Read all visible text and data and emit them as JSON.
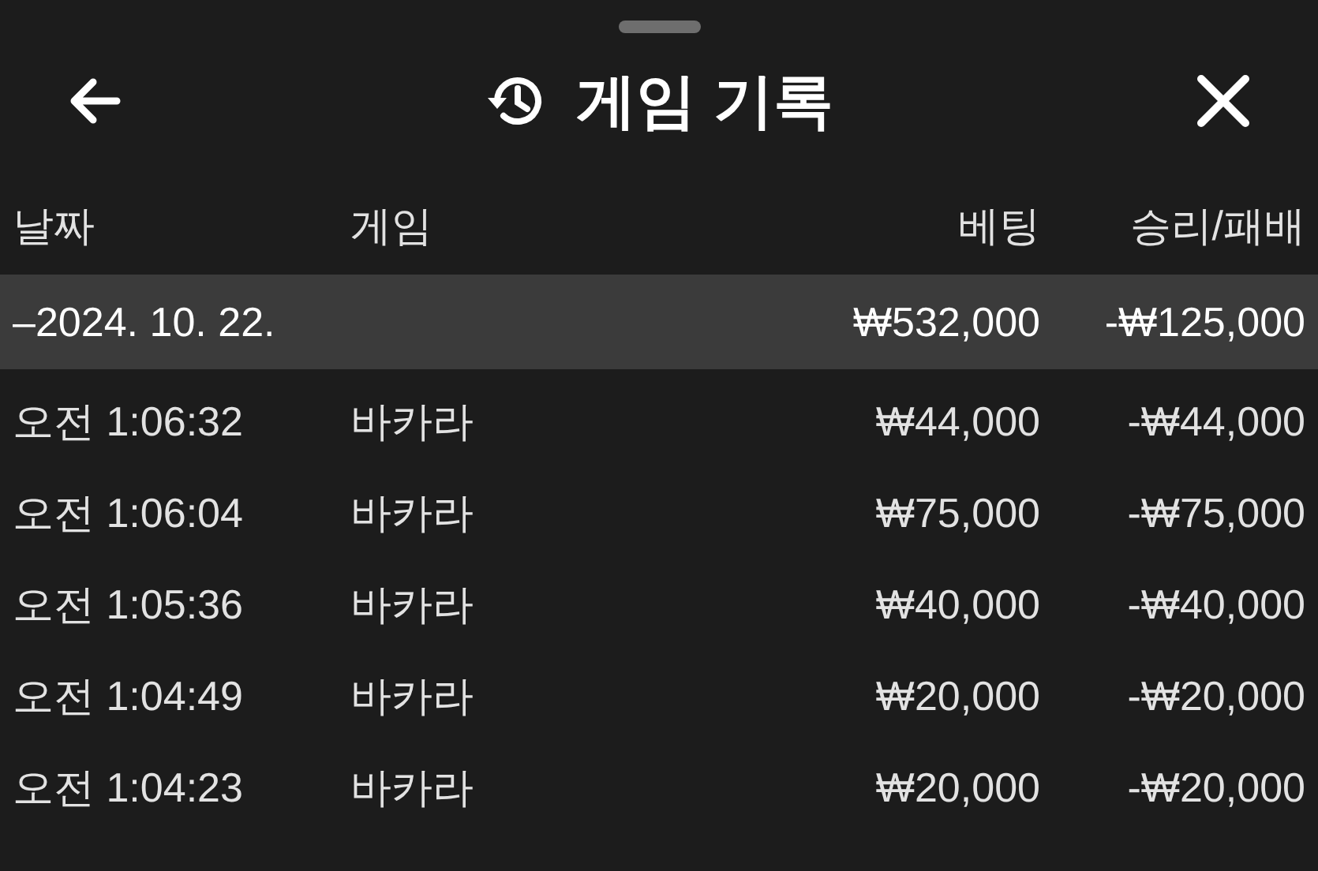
{
  "header": {
    "title": "게임 기록"
  },
  "columns": [
    "날짜",
    "게임",
    "베팅",
    "승리/패배"
  ],
  "groups": [
    {
      "date": "–2024. 10. 22.",
      "bet": "₩532,000",
      "result": "-₩125,000",
      "rows": [
        {
          "time": "오전 1:06:32",
          "game": "바카라",
          "bet": "₩44,000",
          "result": "-₩44,000"
        },
        {
          "time": "오전 1:06:04",
          "game": "바카라",
          "bet": "₩75,000",
          "result": "-₩75,000"
        },
        {
          "time": "오전 1:05:36",
          "game": "바카라",
          "bet": "₩40,000",
          "result": "-₩40,000"
        },
        {
          "time": "오전 1:04:49",
          "game": "바카라",
          "bet": "₩20,000",
          "result": "-₩20,000"
        },
        {
          "time": "오전 1:04:23",
          "game": "바카라",
          "bet": "₩20,000",
          "result": "-₩20,000"
        }
      ]
    }
  ]
}
